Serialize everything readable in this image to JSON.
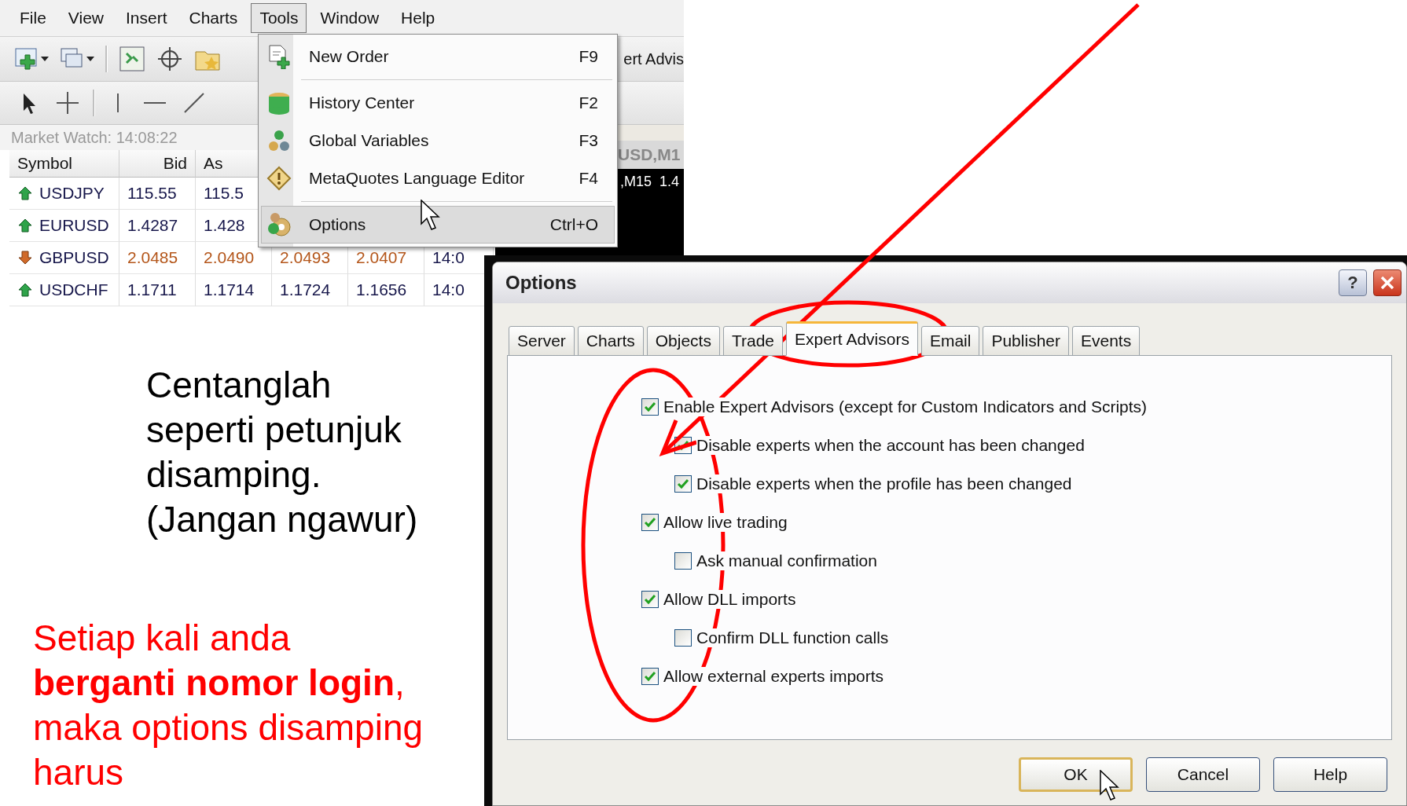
{
  "terminal": {
    "menu_bar": [
      {
        "label": "File",
        "selected": false
      },
      {
        "label": "View",
        "selected": false
      },
      {
        "label": "Insert",
        "selected": false
      },
      {
        "label": "Charts",
        "selected": false
      },
      {
        "label": "Tools",
        "selected": true
      },
      {
        "label": "Window",
        "selected": false
      },
      {
        "label": "Help",
        "selected": false
      }
    ],
    "toolbar_label": "ert Advis",
    "market_watch": {
      "title": "Market Watch: 14:08:22",
      "columns": [
        "Symbol",
        "Bid",
        "As"
      ],
      "rows": [
        {
          "falling": false,
          "cells": [
            "USDJPY",
            "115.55",
            "115.5"
          ]
        },
        {
          "falling": false,
          "cells": [
            "EURUSD",
            "1.4287",
            "1.428"
          ]
        },
        {
          "falling": true,
          "cells": [
            "GBPUSD",
            "2.0485",
            "2.0490",
            "2.0493",
            "2.0407",
            "14:0"
          ]
        },
        {
          "falling": false,
          "cells": [
            "USDCHF",
            "1.1711",
            "1.1714",
            "1.1724",
            "1.1656",
            "14:0"
          ]
        }
      ]
    },
    "chart_window": {
      "title": "USD,M1",
      "timeframe": ",M15",
      "price": "1.4"
    },
    "tools_menu": [
      {
        "kind": "item",
        "label": "New Order",
        "shortcut": "F9",
        "selected": false
      },
      {
        "kind": "separator"
      },
      {
        "kind": "item",
        "label": "History Center",
        "shortcut": "F2",
        "selected": false
      },
      {
        "kind": "item",
        "label": "Global Variables",
        "shortcut": "F3",
        "selected": false
      },
      {
        "kind": "item",
        "label": "MetaQuotes Language Editor",
        "shortcut": "F4",
        "selected": false
      },
      {
        "kind": "separator"
      },
      {
        "kind": "item",
        "label": "Options",
        "shortcut": "Ctrl+O",
        "selected": true
      }
    ]
  },
  "instructions": "Centanglah seperti petunjuk disamping. (Jangan ngawur)",
  "note": "Setiap kali anda **berganti nomor login**, maka options disamping harus",
  "dialog": {
    "title": "Options",
    "help_button": "?",
    "tabs": [
      {
        "label": "Server",
        "selected": false
      },
      {
        "label": "Charts",
        "selected": false
      },
      {
        "label": "Objects",
        "selected": false
      },
      {
        "label": "Trade",
        "selected": false
      },
      {
        "label": "Expert Advisors",
        "selected": true
      },
      {
        "label": "Email",
        "selected": false
      },
      {
        "label": "Publisher",
        "selected": false
      },
      {
        "label": "Events",
        "selected": false
      }
    ],
    "checkboxes": [
      {
        "label": "Enable Expert Advisors (except for Custom Indicators and Scripts)",
        "checked": true,
        "children": [
          {
            "label": "Disable experts when the account has been changed",
            "checked": true
          },
          {
            "label": "Disable experts when the profile has been changed",
            "checked": true
          }
        ]
      },
      {
        "label": "Allow live trading",
        "checked": true,
        "children": [
          {
            "label": "Ask manual confirmation",
            "checked": false
          }
        ]
      },
      {
        "label": "Allow DLL imports",
        "checked": true,
        "children": [
          {
            "label": "Confirm DLL function calls",
            "checked": false
          }
        ]
      },
      {
        "label": "Allow external experts imports",
        "checked": true
      }
    ],
    "buttons": [
      {
        "label": "OK",
        "default": true
      },
      {
        "label": "Cancel",
        "default": false
      },
      {
        "label": "Help",
        "default": false
      }
    ]
  }
}
